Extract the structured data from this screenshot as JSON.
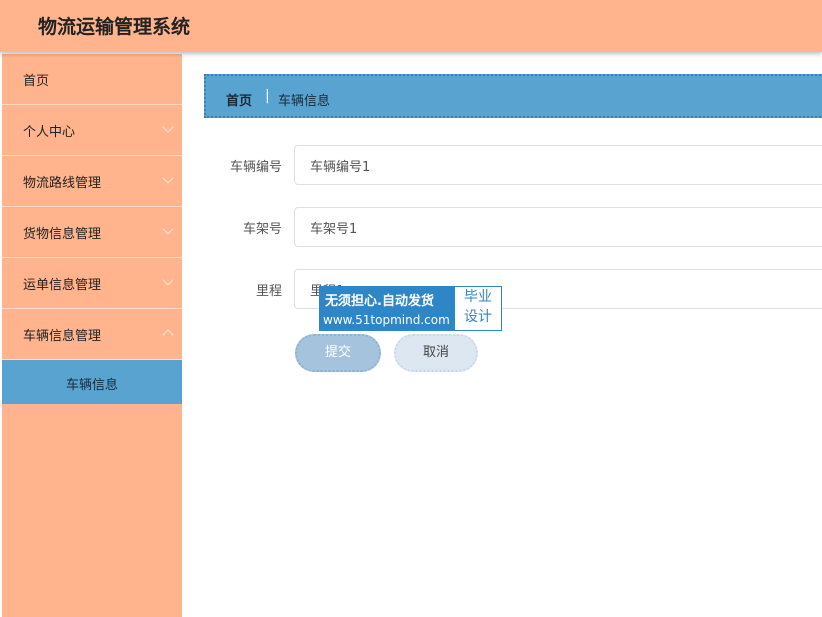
{
  "header": {
    "title": "物流运输管理系统"
  },
  "sidebar": {
    "items": [
      {
        "label": "首页"
      },
      {
        "label": "个人中心"
      },
      {
        "label": "物流路线管理"
      },
      {
        "label": "货物信息管理"
      },
      {
        "label": "运单信息管理"
      },
      {
        "label": "车辆信息管理"
      }
    ],
    "submenu": {
      "label": "车辆信息"
    }
  },
  "breadcrumb": {
    "home": "首页",
    "separator": "|",
    "current": "车辆信息"
  },
  "form": {
    "vehicle_no": {
      "label": "车辆编号",
      "value": "车辆编号1"
    },
    "frame_no": {
      "label": "车架号",
      "value": "车架号1"
    },
    "mileage": {
      "label": "里程",
      "value": "里程1"
    },
    "submit_label": "提交",
    "cancel_label": "取消"
  },
  "watermark": {
    "line1": "无须担心.自动发货",
    "line2": "www.51topmind.com",
    "right_top": "毕业",
    "right_bottom": "设计"
  },
  "colors": {
    "accent": "#ffb48d",
    "active": "#58a3cf"
  }
}
